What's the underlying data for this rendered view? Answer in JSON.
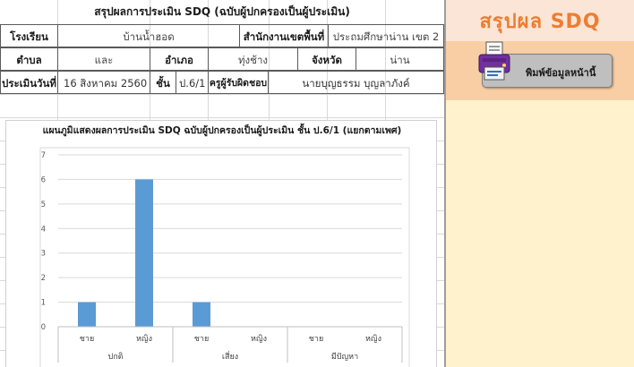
{
  "report": {
    "title": "สรุปผลการประเมิน SDQ  (ฉบับผู้ปกครองเป็นผู้ประเมิน)",
    "school_label": "โรงเรียน",
    "school_value": "บ้านน้ำฮอด",
    "office_label": "สำนักงานเขตพื้นที่",
    "office_value": "ประถมศึกษาน่าน เขต 2",
    "subdistrict_label": "ตำบล",
    "subdistrict_value": "และ",
    "district_label": "อำเภอ",
    "district_value": "ทุ่งช้าง",
    "province_label": "จังหวัด",
    "province_value": "น่าน",
    "date_label": "ประเมินวันที่",
    "date_value": "16 สิงหาคม 2560",
    "grade_label": "ชั้น",
    "grade_value": "ป.6/1",
    "teacher_label": "ครูผู้รับผิดชอบ",
    "teacher_value": "นายบุญธรรม  บุญลาภังค์"
  },
  "chart_data": {
    "type": "bar",
    "title": "แผนภูมิแสดงผลการประเมิน SDQ ฉบับผู้ปกครองเป็นผู้ประเมิน ชั้น ป.6/1 (แยกตามเพศ)",
    "groups": [
      "ปกติ",
      "เสี่ยง",
      "มีปัญหา"
    ],
    "categories": [
      "ชาย",
      "หญิง",
      "ชาย",
      "หญิง",
      "ชาย",
      "หญิง"
    ],
    "group_of_category": [
      0,
      0,
      1,
      1,
      2,
      2
    ],
    "values": [
      1,
      6,
      1,
      0,
      0,
      0
    ],
    "ylim": [
      0,
      7
    ],
    "yticks": [
      0,
      1,
      2,
      3,
      4,
      5,
      6,
      7
    ],
    "bar_color": "#5b9bd5",
    "grid": true
  },
  "sidebar": {
    "summary_title": "สรุปผล SDQ",
    "print_button_label": "พิมพ์ข้อมูลหน้านี้",
    "printer_icon": "printer-icon"
  },
  "colors": {
    "banner_bg": "#fbe5d6",
    "banner_text": "#ed7d31",
    "panel_bg": "#fff2cc",
    "button_bg": "#bfbfbf"
  }
}
